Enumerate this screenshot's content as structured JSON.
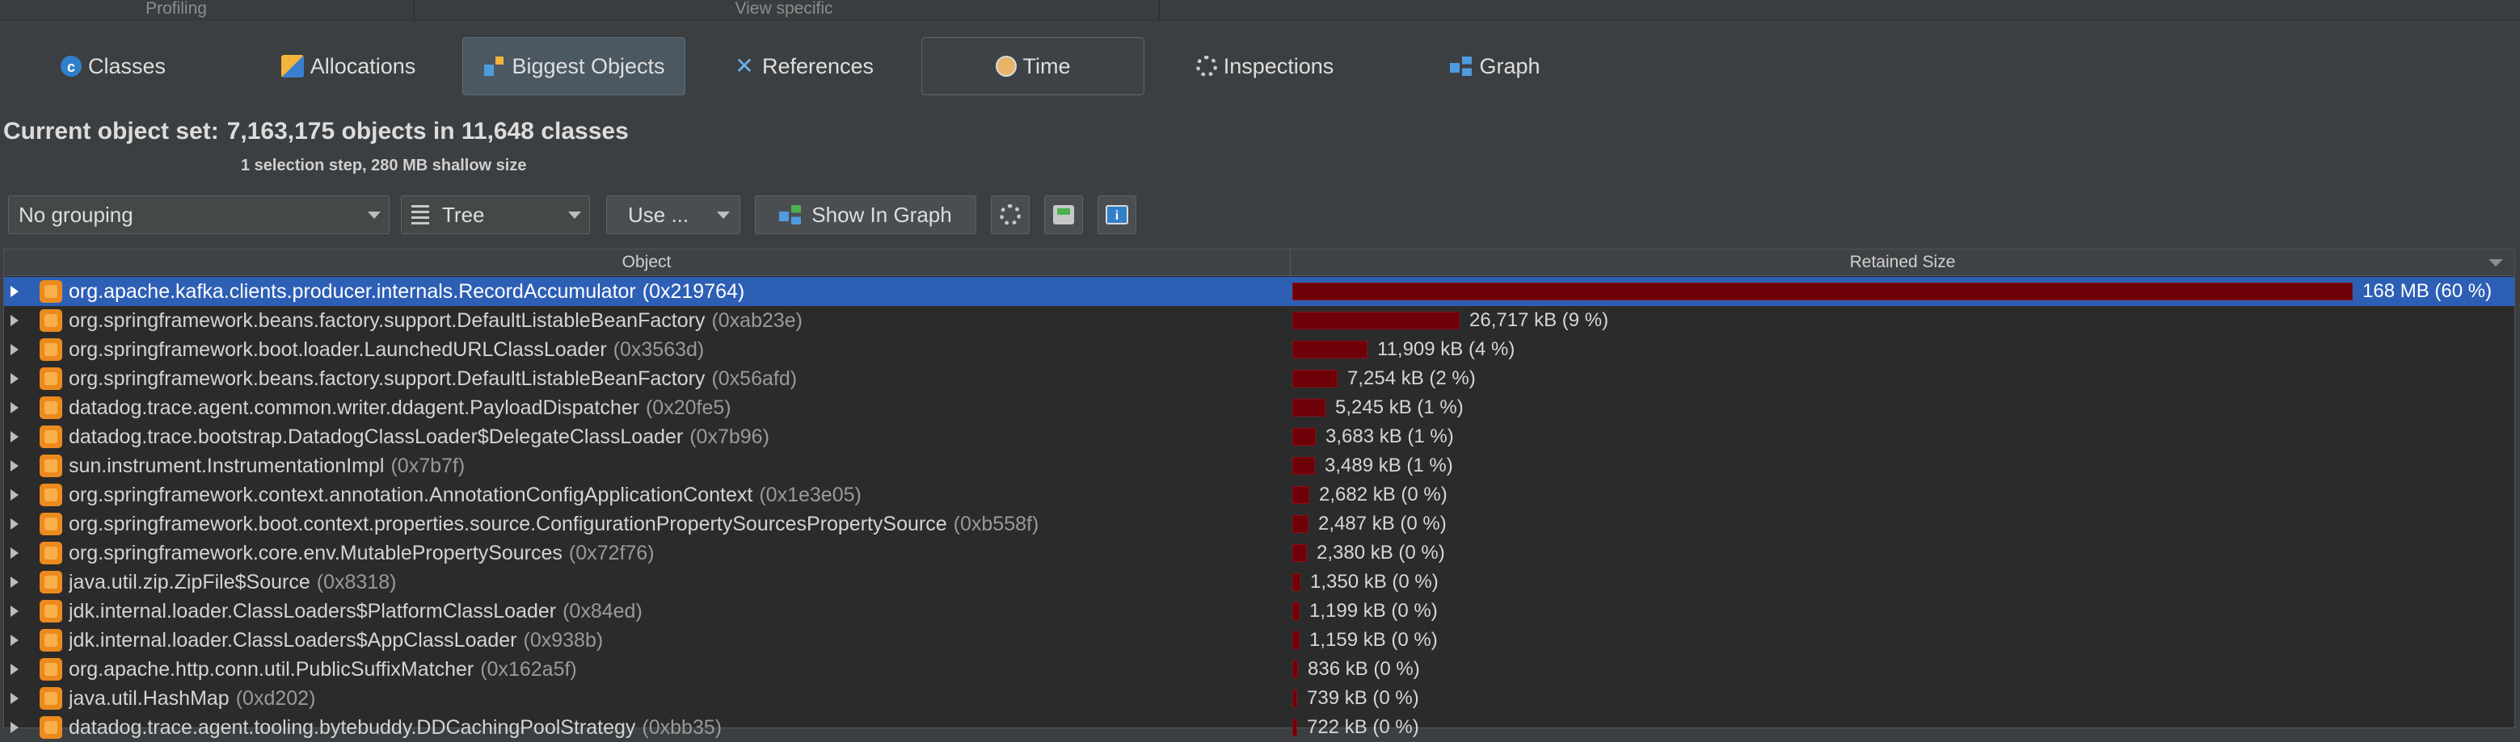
{
  "sections": {
    "profiling": "Profiling",
    "view_specific": "View specific"
  },
  "tabs": [
    {
      "label": "Classes",
      "icon": "classes-icon"
    },
    {
      "label": "Allocations",
      "icon": "allocations-icon"
    },
    {
      "label": "Biggest Objects",
      "icon": "biggest-objects-icon",
      "active": true
    },
    {
      "label": "References",
      "icon": "references-icon"
    },
    {
      "label": "Time",
      "icon": "time-icon"
    },
    {
      "label": "Inspections",
      "icon": "inspections-icon"
    },
    {
      "label": "Graph",
      "icon": "graph-icon"
    }
  ],
  "object_set": {
    "label": "Current object set:",
    "value": "7,163,175 objects in 11,648 classes",
    "sub": "1 selection step, 280 MB shallow size"
  },
  "toolbar": {
    "grouping": "No grouping",
    "view_mode": "Tree",
    "use_label": "Use ...",
    "show_in_graph": "Show In Graph"
  },
  "table": {
    "columns": {
      "object": "Object",
      "retained": "Retained Size"
    },
    "rows": [
      {
        "name": "org.apache.kafka.clients.producer.internals.RecordAccumulator",
        "addr": "(0x219764)",
        "size": "168 MB (60 %)",
        "fraction": 1.0,
        "selected": true
      },
      {
        "name": "org.springframework.beans.factory.support.DefaultListableBeanFactory",
        "addr": "(0xab23e)",
        "size": "26,717 kB (9 %)",
        "fraction": 0.158
      },
      {
        "name": "org.springframework.boot.loader.LaunchedURLClassLoader",
        "addr": "(0x3563d)",
        "size": "11,909 kB (4 %)",
        "fraction": 0.071
      },
      {
        "name": "org.springframework.beans.factory.support.DefaultListableBeanFactory",
        "addr": "(0x56afd)",
        "size": "7,254 kB (2 %)",
        "fraction": 0.043
      },
      {
        "name": "datadog.trace.agent.common.writer.ddagent.PayloadDispatcher",
        "addr": "(0x20fe5)",
        "size": "5,245 kB (1 %)",
        "fraction": 0.031
      },
      {
        "name": "datadog.trace.bootstrap.DatadogClassLoader$DelegateClassLoader",
        "addr": "(0x7b96)",
        "size": "3,683 kB (1 %)",
        "fraction": 0.022
      },
      {
        "name": "sun.instrument.InstrumentationImpl",
        "addr": "(0x7b7f)",
        "size": "3,489 kB (1 %)",
        "fraction": 0.021
      },
      {
        "name": "org.springframework.context.annotation.AnnotationConfigApplicationContext",
        "addr": "(0x1e3e05)",
        "size": "2,682 kB (0 %)",
        "fraction": 0.016
      },
      {
        "name": "org.springframework.boot.context.properties.source.ConfigurationPropertySourcesPropertySource",
        "addr": "(0xb558f)",
        "size": "2,487 kB (0 %)",
        "fraction": 0.015
      },
      {
        "name": "org.springframework.core.env.MutablePropertySources",
        "addr": "(0x72f76)",
        "size": "2,380 kB (0 %)",
        "fraction": 0.014
      },
      {
        "name": "java.util.zip.ZipFile$Source",
        "addr": "(0x8318)",
        "size": "1,350 kB (0 %)",
        "fraction": 0.008
      },
      {
        "name": "jdk.internal.loader.ClassLoaders$PlatformClassLoader",
        "addr": "(0x84ed)",
        "size": "1,199 kB (0 %)",
        "fraction": 0.007
      },
      {
        "name": "jdk.internal.loader.ClassLoaders$AppClassLoader",
        "addr": "(0x938b)",
        "size": "1,159 kB (0 %)",
        "fraction": 0.007
      },
      {
        "name": "org.apache.http.conn.util.PublicSuffixMatcher",
        "addr": "(0x162a5f)",
        "size": "836 kB (0 %)",
        "fraction": 0.005
      },
      {
        "name": "java.util.HashMap",
        "addr": "(0xd202)",
        "size": "739 kB (0 %)",
        "fraction": 0.004
      },
      {
        "name": "datadog.trace.agent.tooling.bytebuddy.DDCachingPoolStrategy",
        "addr": "(0xbb35)",
        "size": "722 kB (0 %)",
        "fraction": 0.004
      }
    ]
  }
}
